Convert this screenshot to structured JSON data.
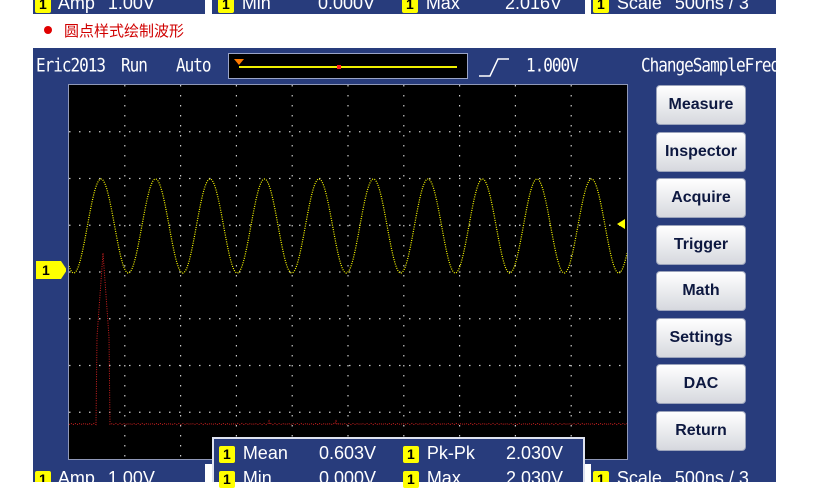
{
  "top_strip": {
    "left": {
      "badge": "1",
      "label": "Amp",
      "value": "1.00V"
    },
    "middle": {
      "min_badge": "1",
      "min_label": "Min",
      "min_value": "0.000V",
      "max_badge": "1",
      "max_label": "Max",
      "max_value": "2.016V"
    },
    "right": {
      "badge": "1",
      "label": "Scale",
      "value": "500ns / 3"
    }
  },
  "caption": "圆点样式绘制波形",
  "header": {
    "title": "Eric2013",
    "run_state": "Run",
    "trigger_mode": "Auto",
    "trigger_level": "1.000V",
    "change_freq": "ChangeSampleFreq"
  },
  "channel_marker": "1",
  "buttons": [
    "Measure",
    "Inspector",
    "Acquire",
    "Trigger",
    "Math",
    "Settings",
    "DAC",
    "Return"
  ],
  "measurements": {
    "mean_badge": "1",
    "mean_label": "Mean",
    "mean_value": "0.603V",
    "pkpk_badge": "1",
    "pkpk_label": "Pk-Pk",
    "pkpk_value": "2.030V",
    "min_badge": "1",
    "min_label": "Min",
    "min_value": "0.000V",
    "max_badge": "1",
    "max_label": "Max",
    "max_value": "2.030V"
  },
  "bottom_strip": {
    "left": {
      "badge": "1",
      "label": "Amp",
      "value": "1.00V"
    },
    "right": {
      "badge": "1",
      "label": "Scale",
      "value": "500ns / 3"
    }
  },
  "colors": {
    "frame": "#283c7c",
    "waveform": "#ffff00",
    "fft": "#d02020",
    "grid": "#c8c8c8"
  }
}
